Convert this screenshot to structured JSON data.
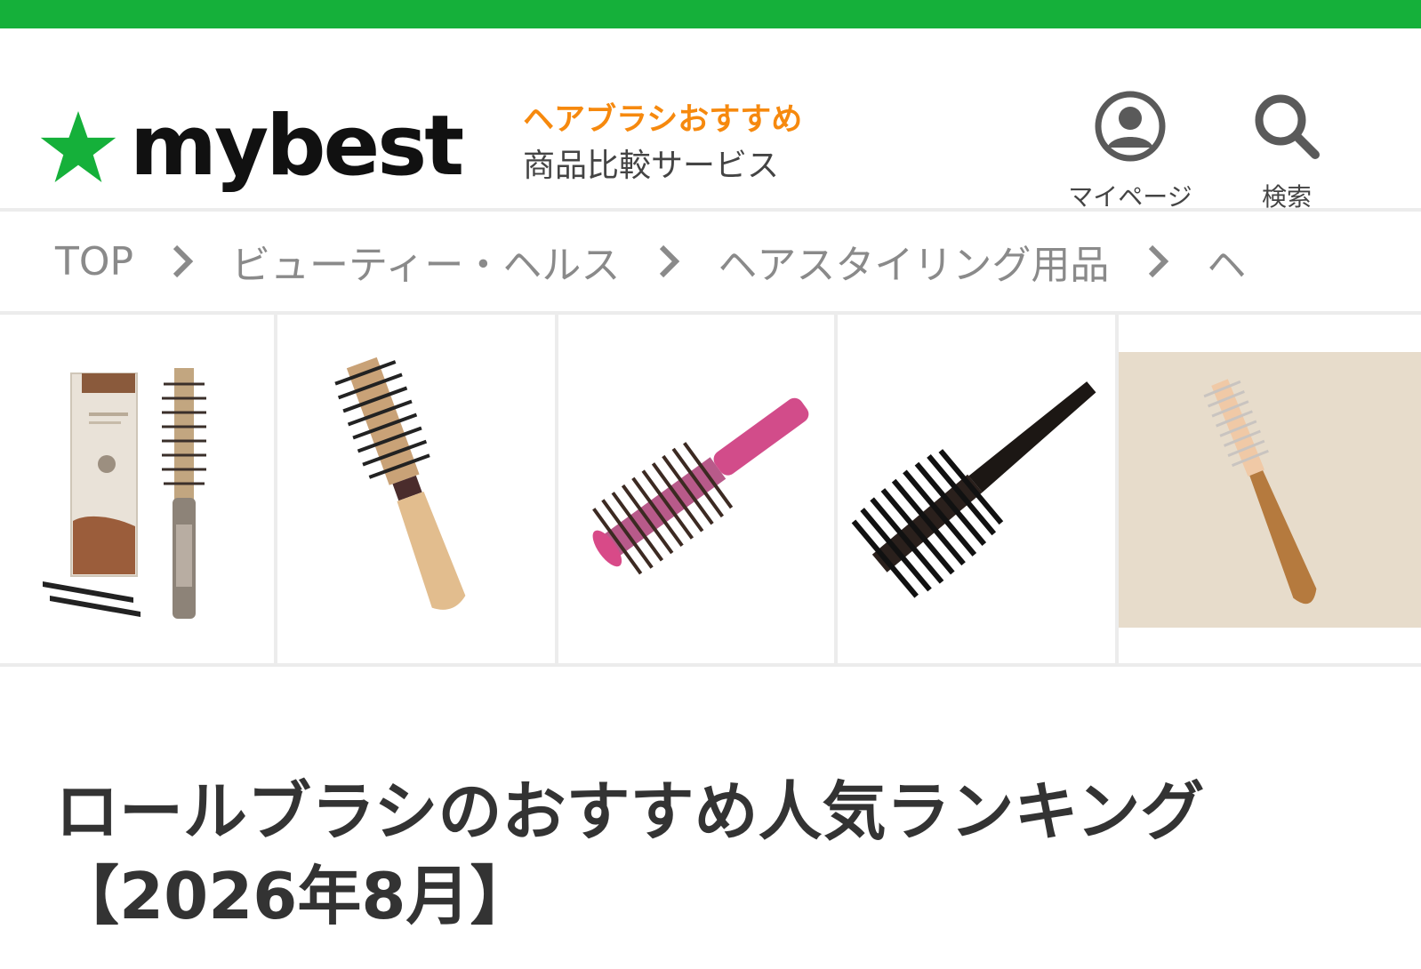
{
  "app": {
    "brand": "mybest",
    "brand_color": "#15b03a",
    "accent_color": "#f6890e"
  },
  "header": {
    "tag_primary": "ヘアブラシおすすめ",
    "tag_secondary": "商品比較サービス",
    "mypage_label": "マイページ",
    "search_label": "検索",
    "logo_icon": "star-icon",
    "mypage_icon": "user-circle-icon",
    "search_icon": "magnifier-icon"
  },
  "breadcrumb": {
    "items": [
      "TOP",
      "ビューティー・ヘルス",
      "ヘアスタイリング用品",
      "ヘ"
    ],
    "separator_icon": "chevron-right-icon"
  },
  "product_images": [
    {
      "name": "roll-brush-with-box-and-clips"
    },
    {
      "name": "wooden-handle-roll-brush"
    },
    {
      "name": "pink-handle-roll-brush"
    },
    {
      "name": "black-roll-brush"
    },
    {
      "name": "wooden-spiral-roll-brush"
    }
  ],
  "main": {
    "title_line1": "ロールブラシのおすすめ人気ランキング",
    "title_line2": "【2026年8月】"
  }
}
